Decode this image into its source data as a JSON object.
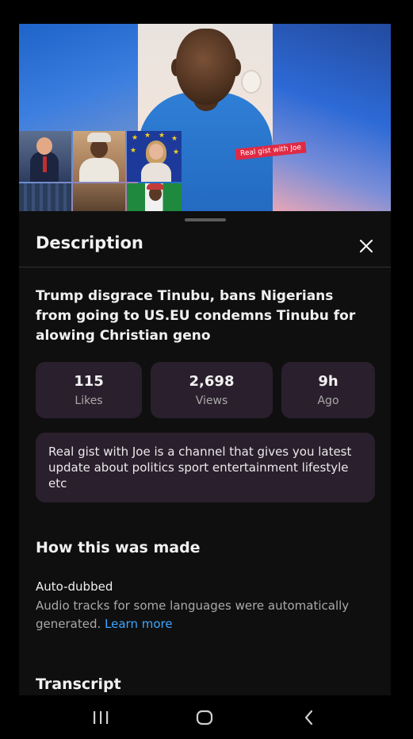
{
  "video": {
    "overlay_tag": "Real gist with Joe"
  },
  "sheet": {
    "title": "Description",
    "close_icon": "close-icon"
  },
  "video_title": "Trump disgrace Tinubu, bans Nigerians from going to US.EU condemns Tinubu for alowing Christian geno",
  "stats": [
    {
      "value": "115",
      "label": "Likes"
    },
    {
      "value": "2,698",
      "label": "Views"
    },
    {
      "value": "9h",
      "label": "Ago"
    }
  ],
  "about_text": "Real gist with Joe is a channel that gives you latest update about politics sport entertainment lifestyle etc",
  "how_made": {
    "heading": "How this was made",
    "subheading": "Auto-dubbed",
    "text": "Audio tracks for some languages were automatically generated.",
    "link": "Learn more"
  },
  "transcript_heading": "Transcript",
  "navbar": {
    "icons": [
      "recents-icon",
      "home-icon",
      "back-icon"
    ]
  },
  "colors": {
    "background": "#0f0f0f",
    "card": "#2a1f2c",
    "link": "#3ea6ff",
    "tag": "#e02a43"
  }
}
